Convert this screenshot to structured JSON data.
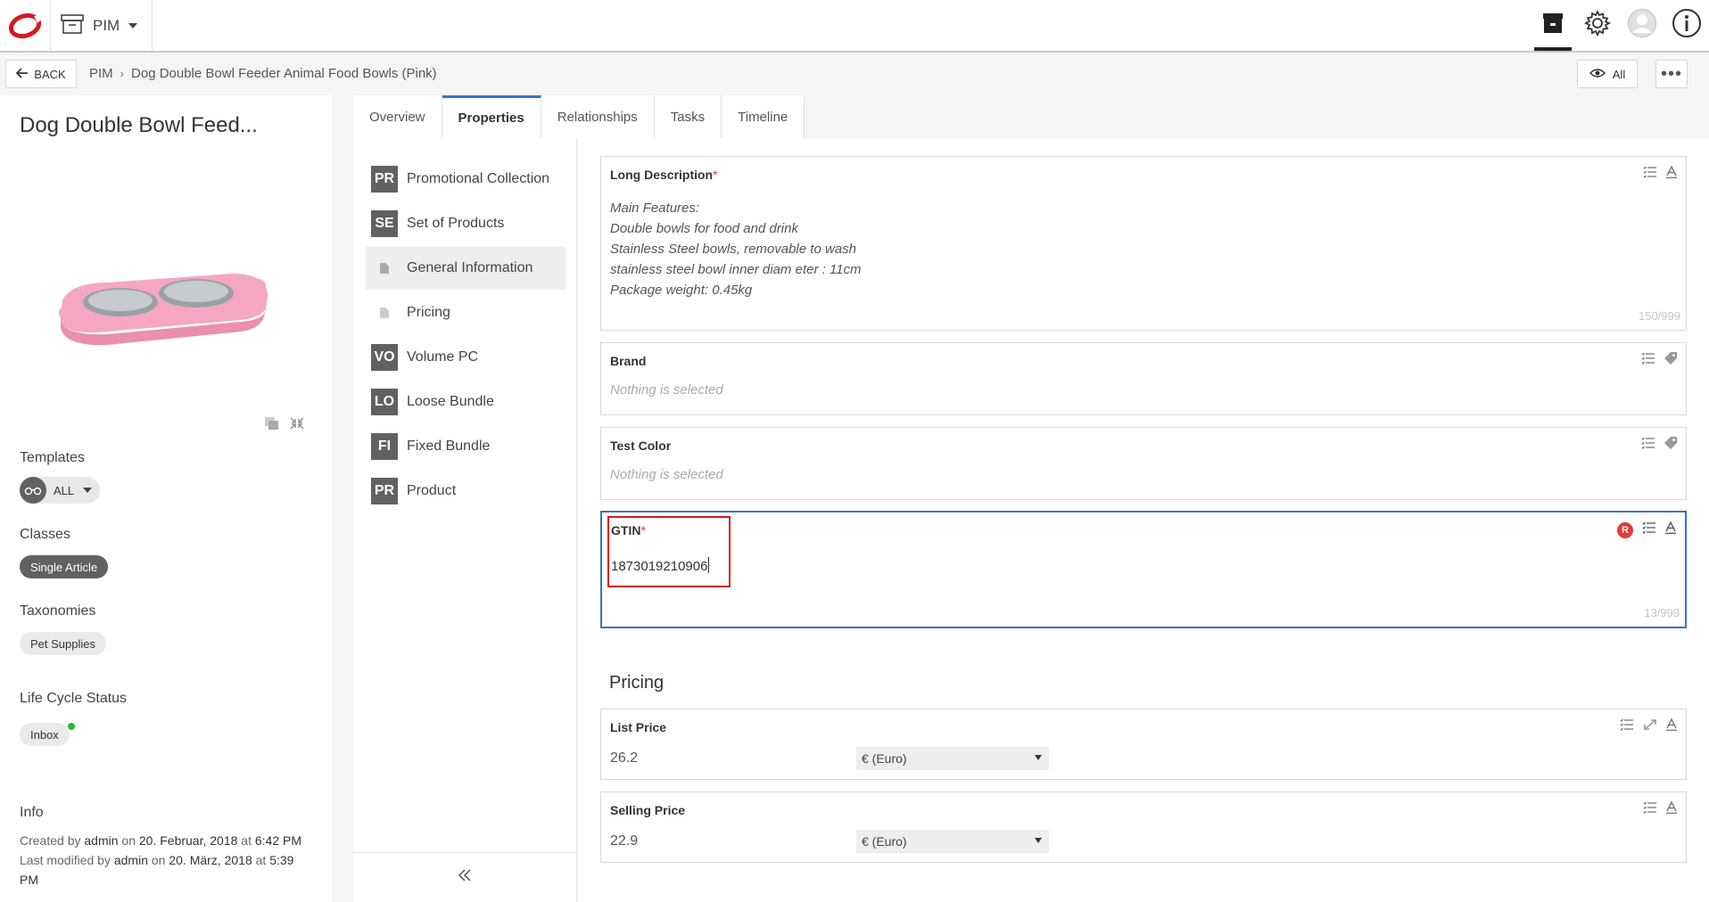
{
  "app": {
    "module_label": "PIM"
  },
  "breadcrumb": {
    "back_label": "BACK",
    "items": [
      "PIM",
      "Dog Double Bowl Feeder Animal Food Bowls (Pink)"
    ],
    "view_label": "All",
    "more_label": "•••"
  },
  "product": {
    "title": "Dog Double Bowl Feed...",
    "templates": {
      "label": "Templates",
      "value": "ALL"
    },
    "classes": {
      "label": "Classes",
      "value": "Single Article"
    },
    "taxonomies": {
      "label": "Taxonomies",
      "value": "Pet Supplies"
    },
    "lifecycle": {
      "label": "Life Cycle Status",
      "value": "Inbox",
      "status_color": "#19c038"
    },
    "info": {
      "label": "Info",
      "created_prefix": "Created by",
      "created_by": "admin",
      "created_on_word": "on",
      "created_date": "20. Februar, 2018",
      "created_at_word": "at",
      "created_time": "6:42 PM",
      "modified_prefix": "Last modified by",
      "modified_by": "admin",
      "modified_on_word": "on",
      "modified_date": "20. März, 2018",
      "modified_at_word": "at",
      "modified_time": "5:39 PM"
    }
  },
  "tabs": [
    "Overview",
    "Properties",
    "Relationships",
    "Tasks",
    "Timeline"
  ],
  "active_tab": "Properties",
  "nav": [
    {
      "badge": "PR",
      "label": "Promotional Collection"
    },
    {
      "badge": "SE",
      "label": "Set of Products"
    },
    {
      "badge": "",
      "label": "General Information",
      "icon": "document-icon",
      "active": true
    },
    {
      "badge": "",
      "label": "Pricing",
      "icon": "document-icon"
    },
    {
      "badge": "VO",
      "label": "Volume PC"
    },
    {
      "badge": "LO",
      "label": "Loose Bundle"
    },
    {
      "badge": "FI",
      "label": "Fixed Bundle"
    },
    {
      "badge": "PR",
      "label": "Product"
    }
  ],
  "fields": {
    "long_description": {
      "label": "Long Description",
      "required_mark": "*",
      "lines": [
        "Main Features:",
        "Double bowls for food and drink",
        "Stainless Steel bowls, removable to wash",
        "stainless steel bowl inner diam eter : 11cm",
        "Package weight: 0.45kg"
      ],
      "counter": "150/999"
    },
    "brand": {
      "label": "Brand",
      "placeholder": "Nothing is selected"
    },
    "test_color": {
      "label": "Test Color",
      "placeholder": "Nothing is selected"
    },
    "gtin": {
      "label": "GTIN",
      "required_mark": "*",
      "value": "1873019210906",
      "counter": "13/999",
      "badge": "R"
    }
  },
  "pricing": {
    "title": "Pricing",
    "list_price": {
      "label": "List Price",
      "value": "26.2",
      "currency": "€ (Euro)"
    },
    "selling_price": {
      "label": "Selling Price",
      "value": "22.9",
      "currency": "€ (Euro)"
    }
  },
  "colors": {
    "accent": "#3b6fd4",
    "brand_red": "#d8181f",
    "badge_gray": "#616161"
  }
}
